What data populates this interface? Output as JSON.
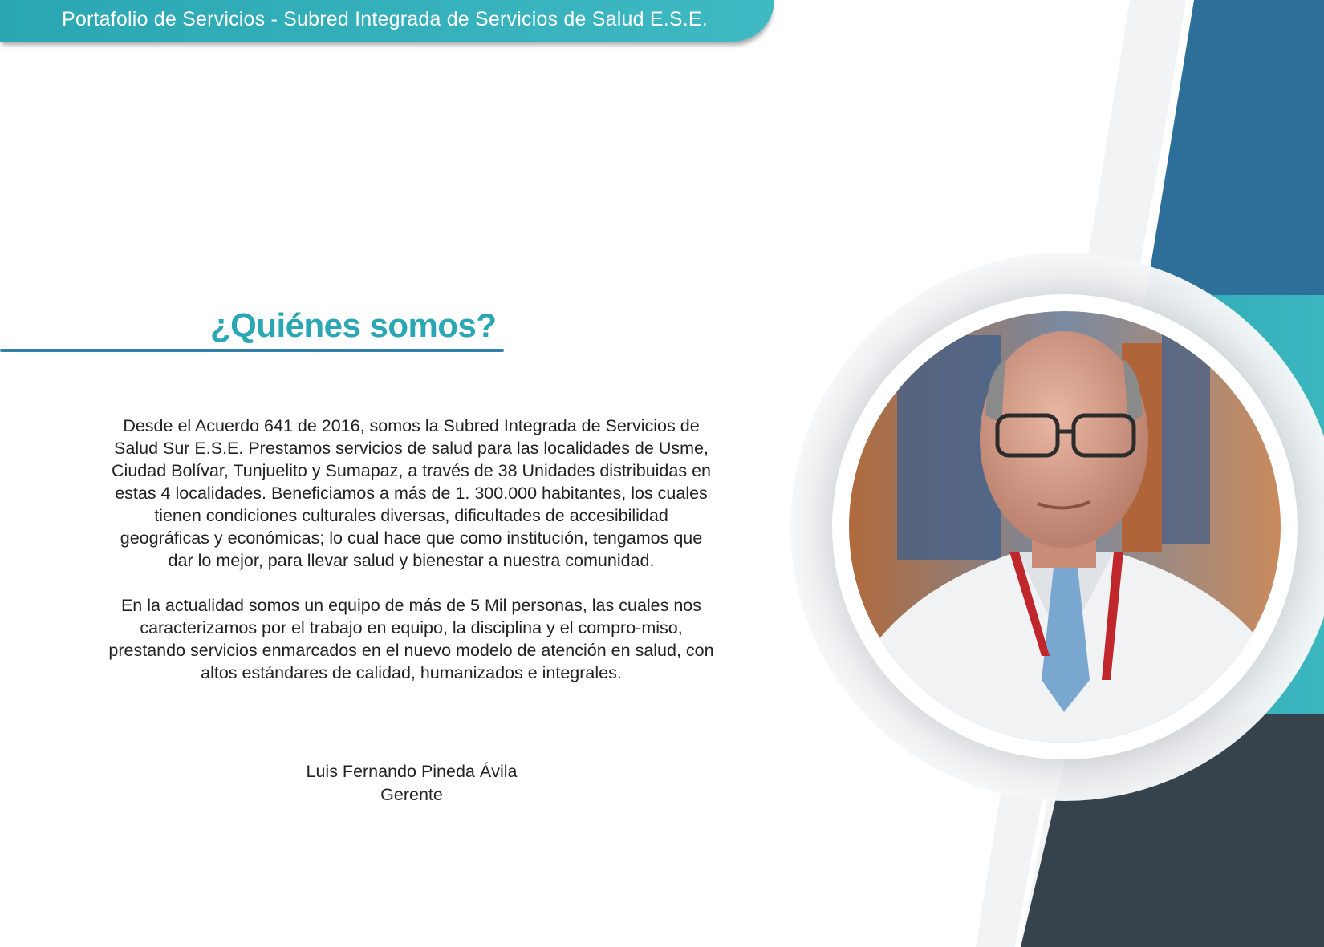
{
  "header": {
    "title": "Portafolio de Servicios - Subred Integrada de Servicios de Salud E.S.E."
  },
  "section": {
    "title": "¿Quiénes somos?",
    "paragraphs": [
      "Desde el Acuerdo 641 de 2016, somos la Subred Integrada de Servicios de Salud Sur E.S.E. Prestamos servicios de salud para las localidades de Usme, Ciudad Bolívar, Tunjuelito y Sumapaz, a través de 38 Unidades distribuidas en estas 4 localidades. Beneficiamos a más de 1. 300.000 habitantes, los cuales tienen condiciones culturales diversas, dificultades de accesibilidad geográficas y económicas; lo cual hace que como institución, tengamos que dar lo mejor, para llevar salud y bienestar a nuestra comunidad.",
      "En la actualidad somos un equipo de más de 5 Mil personas, las cuales nos caracterizamos por el trabajo en equipo, la disciplina y el compro-miso, prestando servicios enmarcados en el nuevo modelo de atención en salud, con altos estándares de calidad, humanizados e integrales."
    ]
  },
  "signature": {
    "name": "Luis Fernando Pineda Ávila",
    "role": "Gerente"
  },
  "colors": {
    "teal": "#2aa7b3",
    "blue": "#2f7fa6",
    "steel_blue": "#2d6f98",
    "dark_slate": "#37434c",
    "light_gray": "#e9eaec"
  }
}
